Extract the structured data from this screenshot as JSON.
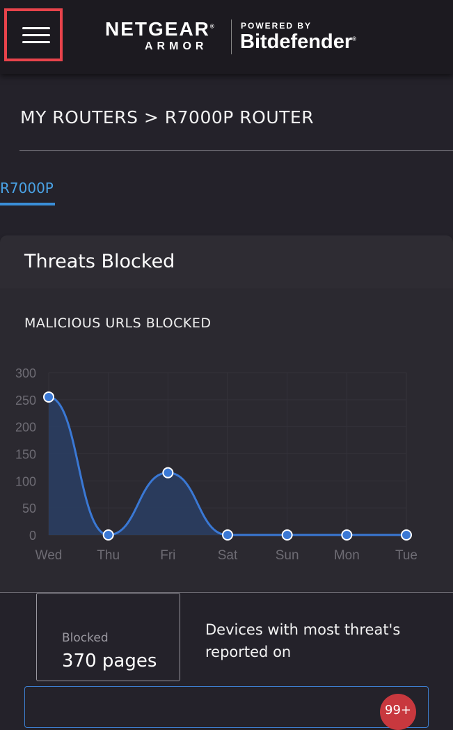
{
  "header": {
    "brand_name": "NETGEAR",
    "brand_trademark": "®",
    "brand_sub": "ARMOR",
    "powered_by": "POWERED BY",
    "partner": "Bitdefender",
    "partner_trademark": "®"
  },
  "breadcrumb": "MY ROUTERS > R7000P ROUTER",
  "tab": {
    "label": "R7000P"
  },
  "card": {
    "title": "Threats Blocked",
    "chart_title": "MALICIOUS URLS BLOCKED"
  },
  "colors": {
    "accent": "#3a8fd8",
    "line": "#3a78d4",
    "menu_highlight": "#e8434b",
    "badge": "#c8383e"
  },
  "chart_data": {
    "type": "area",
    "categories": [
      "Wed",
      "Thu",
      "Fri",
      "Sat",
      "Sun",
      "Mon",
      "Tue"
    ],
    "series": [
      {
        "values": [
          255,
          0,
          115,
          0,
          0,
          0,
          0
        ]
      }
    ],
    "ylim": [
      0,
      300
    ],
    "yticks": [
      0,
      50,
      100,
      150,
      200,
      250,
      300
    ],
    "grid": true,
    "legend": "none"
  },
  "stats": {
    "blocked_label": "Blocked",
    "blocked_value": "370 pages",
    "devices_text": "Devices with most threat's reported on"
  },
  "device_badge": "99+"
}
